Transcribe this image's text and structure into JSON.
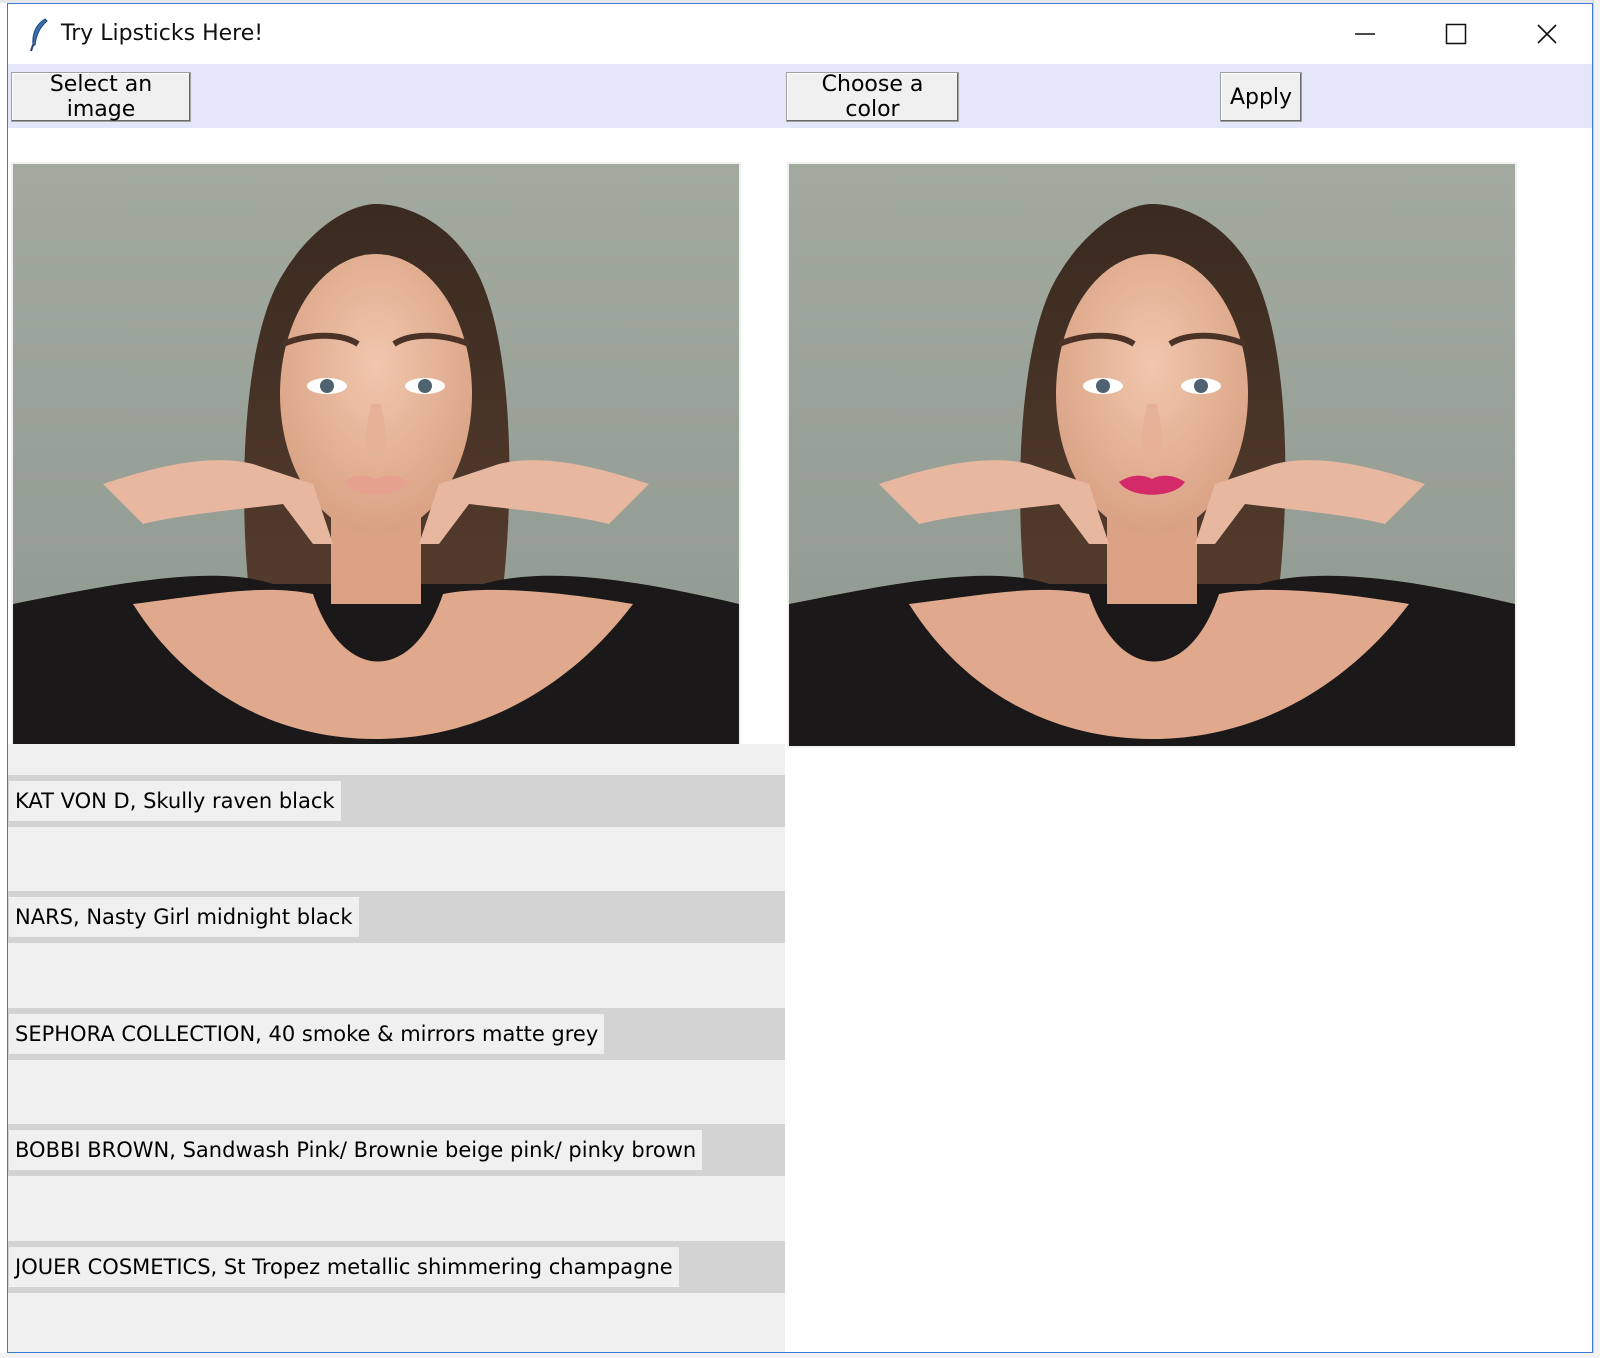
{
  "window": {
    "title": "Try Lipsticks Here!",
    "controls": [
      "minimize-icon",
      "maximize-icon",
      "close-icon"
    ]
  },
  "toolbar": {
    "background": "#e4e6f9",
    "select_label": "Select an image",
    "choose_label": "Choose a color",
    "apply_label": "Apply"
  },
  "images": {
    "original": {
      "lip_color": "#e6a08e"
    },
    "result": {
      "lip_color": "#d42a6a"
    }
  },
  "lipsticks": [
    {
      "label": "KAT VON D, Skully raven black"
    },
    {
      "label": "NARS, Nasty Girl midnight black"
    },
    {
      "label": "SEPHORA COLLECTION, 40 smoke & mirrors matte grey"
    },
    {
      "label": "BOBBI BROWN, Sandwash Pink/ Brownie beige pink/ pinky brown"
    },
    {
      "label": "JOUER COSMETICS, St Tropez metallic shimmering champagne"
    }
  ]
}
